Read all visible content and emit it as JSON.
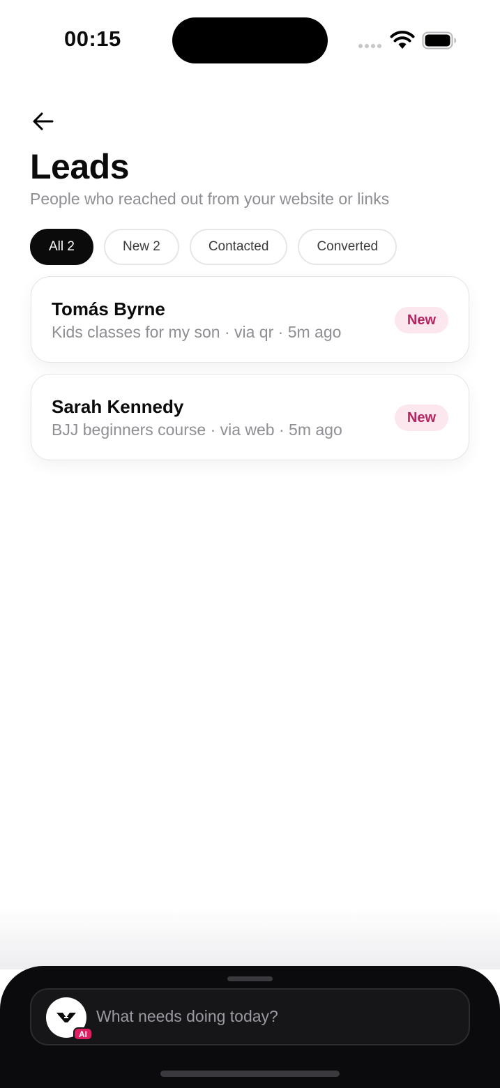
{
  "status_bar": {
    "time": "00:15"
  },
  "header": {
    "title": "Leads",
    "subtitle": "People who reached out from your website or links"
  },
  "filters": [
    {
      "label": "All 2",
      "active": true
    },
    {
      "label": "New 2",
      "active": false
    },
    {
      "label": "Contacted",
      "active": false
    },
    {
      "label": "Converted",
      "active": false
    }
  ],
  "leads": [
    {
      "name": "Tomás Byrne",
      "meta": "Kids classes for my son · via qr · 5m ago",
      "status": "New"
    },
    {
      "name": "Sarah Kennedy",
      "meta": "BJJ beginners course · via web · 5m ago",
      "status": "New"
    }
  ],
  "assistant": {
    "placeholder": "What needs doing today?",
    "badge": "AI"
  },
  "colors": {
    "badge_bg": "#fde7ef",
    "badge_text": "#b4245f",
    "ai_badge": "#e11d63",
    "sheet_bg": "#0b0b0d"
  },
  "icons": [
    "back-arrow-icon",
    "wifi-icon",
    "battery-icon",
    "signal-dots-icon",
    "assistant-logo-icon"
  ]
}
